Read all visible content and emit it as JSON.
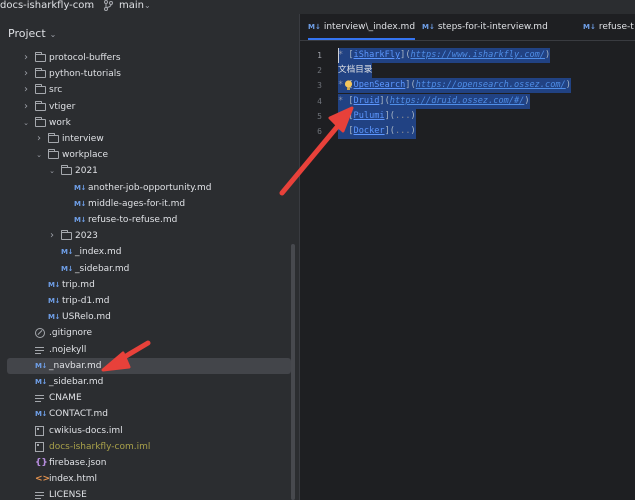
{
  "topbar": {
    "project_name": "docs-isharkfly-com",
    "branch": "main"
  },
  "panel": {
    "title": "Project"
  },
  "tree": [
    {
      "label": "protocol-buffers",
      "type": "folder",
      "indent": 1,
      "arrow": "collapsed"
    },
    {
      "label": "python-tutorials",
      "type": "folder",
      "indent": 1,
      "arrow": "collapsed"
    },
    {
      "label": "src",
      "type": "folder",
      "indent": 1,
      "arrow": "collapsed"
    },
    {
      "label": "vtiger",
      "type": "folder",
      "indent": 1,
      "arrow": "collapsed"
    },
    {
      "label": "work",
      "type": "folder",
      "indent": 1,
      "arrow": "expanded"
    },
    {
      "label": "interview",
      "type": "folder",
      "indent": 2,
      "arrow": "collapsed"
    },
    {
      "label": "workplace",
      "type": "folder",
      "indent": 2,
      "arrow": "expanded"
    },
    {
      "label": "2021",
      "type": "folder",
      "indent": 3,
      "arrow": "expanded"
    },
    {
      "label": "another-job-opportunity.md",
      "type": "md",
      "indent": 4
    },
    {
      "label": "middle-ages-for-it.md",
      "type": "md",
      "indent": 4
    },
    {
      "label": "refuse-to-refuse.md",
      "type": "md",
      "indent": 4
    },
    {
      "label": "2023",
      "type": "folder",
      "indent": 3,
      "arrow": "collapsed"
    },
    {
      "label": "_index.md",
      "type": "md",
      "indent": 3
    },
    {
      "label": "_sidebar.md",
      "type": "md",
      "indent": 3
    },
    {
      "label": "trip.md",
      "type": "md",
      "indent": 2
    },
    {
      "label": "trip-d1.md",
      "type": "md",
      "indent": 2
    },
    {
      "label": "USRelo.md",
      "type": "md",
      "indent": 2
    },
    {
      "label": ".gitignore",
      "type": "gitignore",
      "indent": 1
    },
    {
      "label": ".nojekyll",
      "type": "text",
      "indent": 1
    },
    {
      "label": "_navbar.md",
      "type": "md",
      "indent": 1,
      "selected": true
    },
    {
      "label": "_sidebar.md",
      "type": "md",
      "indent": 1
    },
    {
      "label": "CNAME",
      "type": "text",
      "indent": 1
    },
    {
      "label": "CONTACT.md",
      "type": "md",
      "indent": 1
    },
    {
      "label": "cwikius-docs.iml",
      "type": "iml",
      "indent": 1
    },
    {
      "label": "docs-isharkfly-com.iml",
      "type": "iml",
      "indent": 1,
      "color": "#a8a04a"
    },
    {
      "label": "firebase.json",
      "type": "json",
      "indent": 1
    },
    {
      "label": "index.html",
      "type": "html",
      "indent": 1
    },
    {
      "label": "LICENSE",
      "type": "text",
      "indent": 1
    }
  ],
  "tabs": [
    {
      "label": "interview\\_index.md",
      "icon": "M↓"
    },
    {
      "label": "steps-for-it-interview.md",
      "icon": "M↓"
    },
    {
      "label": "refuse-t",
      "icon": "M↓"
    }
  ],
  "editor": {
    "line_numbers": [
      "1",
      "2",
      "3",
      "4",
      "5",
      "6"
    ],
    "lines": [
      {
        "bullet": "*",
        "ref": "iSharkFly",
        "url": "https://www.isharkfly.com/",
        "indent": 0
      },
      {
        "text": "文档目录",
        "indent": 0
      },
      {
        "bullet": "*",
        "ref": "OpenSearch",
        "url": "https://opensearch.ossez.com/",
        "indent": 1
      },
      {
        "bullet": "*",
        "ref": "Druid",
        "url": "https://druid.ossez.com/#/",
        "indent": 1
      },
      {
        "bullet": "*",
        "ref": "Pulumi",
        "url": "...",
        "indent": 1
      },
      {
        "bullet": "*",
        "ref": "Docker",
        "url": "...",
        "indent": 1
      }
    ]
  },
  "icons": {
    "markdown": "M↓",
    "json": "{}",
    "html": "<>",
    "bulb": "lightbulb-icon"
  },
  "colors": {
    "selection": "#214283",
    "accent": "#3574f0",
    "arrow": "#e8413a"
  }
}
